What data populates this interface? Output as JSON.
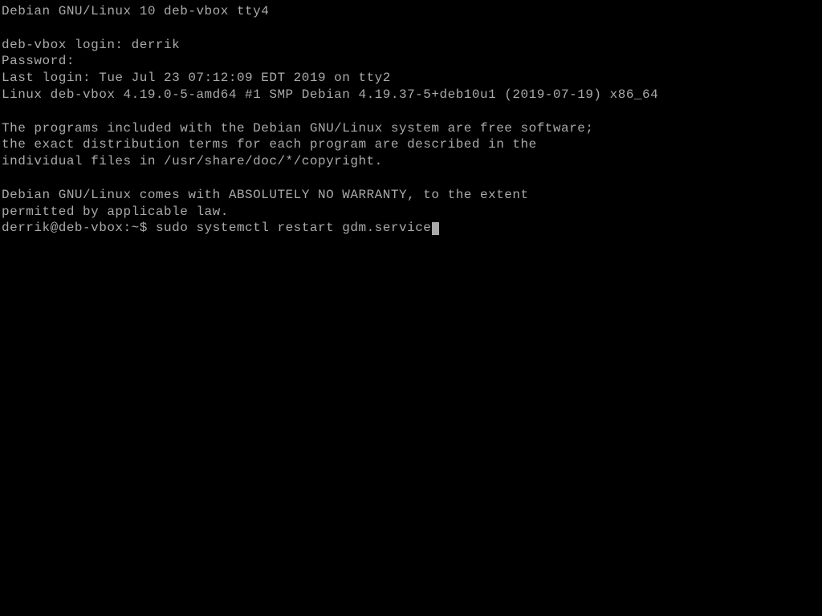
{
  "terminal": {
    "banner": "Debian GNU/Linux 10 deb-vbox tty4",
    "login_prompt": "deb-vbox login: ",
    "username": "derrik",
    "password_prompt": "Password:",
    "last_login": "Last login: Tue Jul 23 07:12:09 EDT 2019 on tty2",
    "kernel_line": "Linux deb-vbox 4.19.0-5-amd64 #1 SMP Debian 4.19.37-5+deb10u1 (2019-07-19) x86_64",
    "motd_1": "The programs included with the Debian GNU/Linux system are free software;",
    "motd_2": "the exact distribution terms for each program are described in the",
    "motd_3": "individual files in /usr/share/doc/*/copyright.",
    "motd_4": "Debian GNU/Linux comes with ABSOLUTELY NO WARRANTY, to the extent",
    "motd_5": "permitted by applicable law.",
    "shell_prompt": "derrik@deb-vbox:~$ ",
    "current_command": "sudo systemctl restart gdm.service"
  }
}
